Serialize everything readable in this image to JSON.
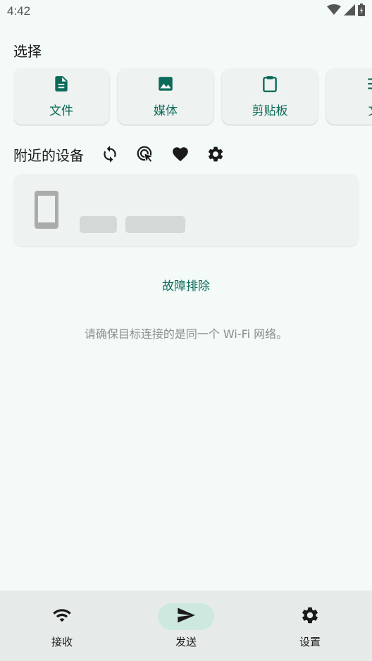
{
  "status_bar": {
    "time": "4:42"
  },
  "select_section": {
    "title": "选择",
    "cards": [
      {
        "label": "文件",
        "icon": "file-icon"
      },
      {
        "label": "媒体",
        "icon": "image-icon"
      },
      {
        "label": "剪贴板",
        "icon": "clipboard-icon"
      },
      {
        "label": "文",
        "icon": "text-icon"
      }
    ]
  },
  "nearby": {
    "title": "附近的设备",
    "icons": [
      "refresh-icon",
      "target-cursor-icon",
      "heart-icon",
      "gear-icon"
    ]
  },
  "troubleshoot_label": "故障排除",
  "hint_text": "请确保目标连接的是同一个 Wi-Fi 网络。",
  "bottom_nav": {
    "items": [
      {
        "label": "接收",
        "icon": "wifi-icon",
        "active": false
      },
      {
        "label": "发送",
        "icon": "send-icon",
        "active": true
      },
      {
        "label": "设置",
        "icon": "gear-icon",
        "active": false
      }
    ]
  },
  "colors": {
    "accent": "#0b6b5a",
    "background": "#f3faf7",
    "nav_background": "#e6ebe9",
    "active_pill": "#cce8df"
  }
}
